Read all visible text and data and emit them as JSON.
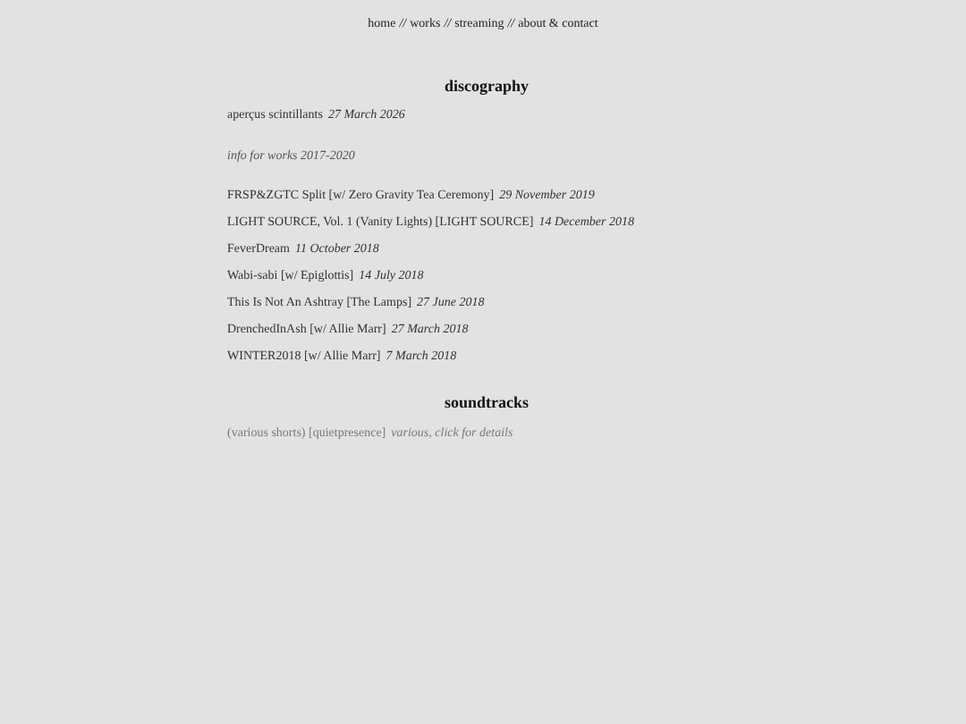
{
  "nav": {
    "links": [
      "home",
      "works",
      "streaming",
      "about & contact"
    ],
    "separator": "//"
  },
  "discography": {
    "heading": "discography",
    "featured": {
      "title": "aperçus scintillants",
      "date": "27 March 2026"
    },
    "info_link": "info for works 2017-2020",
    "releases": [
      {
        "title": "FRSP&ZGTC Split [w/ Zero Gravity Tea Ceremony]",
        "date": "29 November 2019"
      },
      {
        "title": "LIGHT SOURCE, Vol. 1 (Vanity Lights) [LIGHT SOURCE]",
        "date": "14 December 2018"
      },
      {
        "title": "FeverDream",
        "date": "11 October 2018"
      },
      {
        "title": "Wabi-sabi [w/ Epiglottis]",
        "date": "14 July 2018"
      },
      {
        "title": "This Is Not An Ashtray [The Lamps]",
        "date": "27 June 2018"
      },
      {
        "title": "DrenchedInAsh [w/ Allie Marr]",
        "date": "27 March 2018"
      },
      {
        "title": "WINTER2018 [w/ Allie Marr]",
        "date": "7 March 2018"
      }
    ]
  },
  "soundtracks": {
    "heading": "soundtracks",
    "entries": [
      {
        "title": "(various shorts) [quietpresence]",
        "date": "various, click for details"
      }
    ]
  }
}
